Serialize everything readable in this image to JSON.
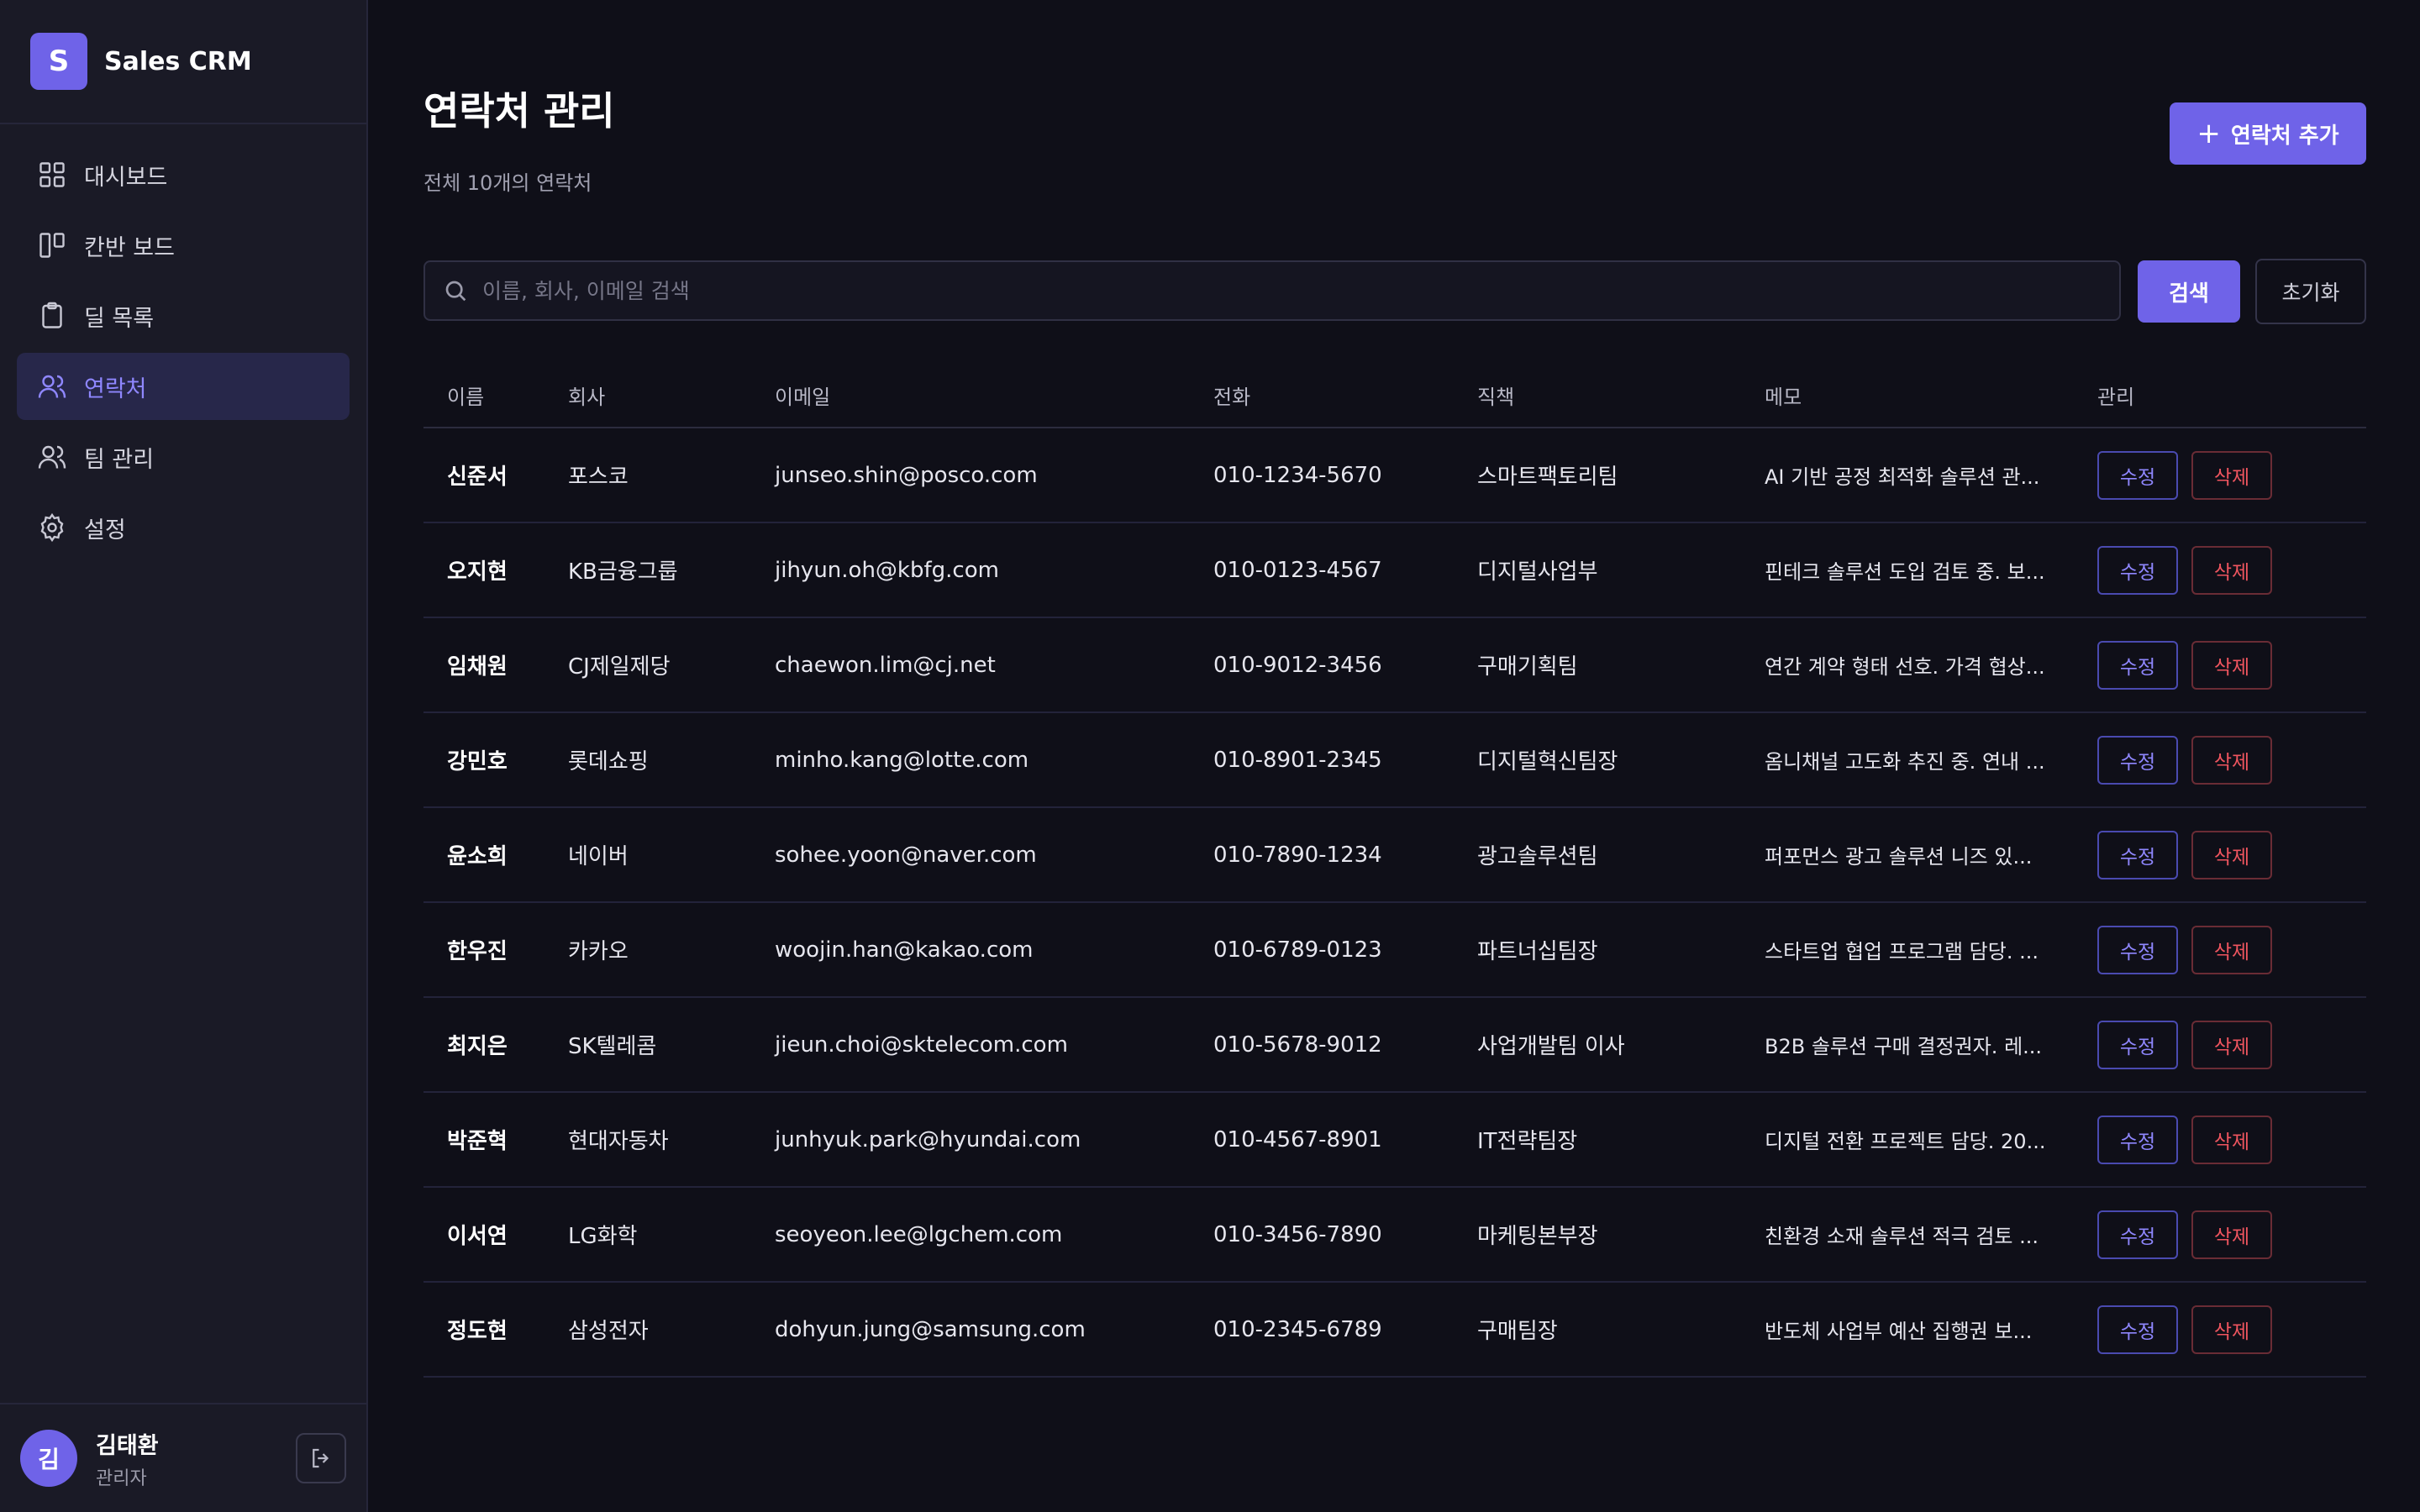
{
  "app": {
    "logo_letter": "S",
    "name": "Sales CRM"
  },
  "nav": [
    {
      "label": "대시보드",
      "icon": "dashboard-icon"
    },
    {
      "label": "칸반 보드",
      "icon": "kanban-icon"
    },
    {
      "label": "딜 목록",
      "icon": "clipboard-icon"
    },
    {
      "label": "연락처",
      "icon": "contacts-icon",
      "active": true
    },
    {
      "label": "팀 관리",
      "icon": "team-icon"
    },
    {
      "label": "설정",
      "icon": "gear-icon"
    }
  ],
  "user": {
    "avatar": "김",
    "name": "김태환",
    "role": "관리자"
  },
  "page": {
    "title": "연락처 관리",
    "subtitle": "전체 10개의 연락처",
    "add_label": "연락처 추가"
  },
  "search": {
    "placeholder": "이름, 회사, 이메일 검색",
    "value": "",
    "search_label": "검색",
    "reset_label": "초기화"
  },
  "table": {
    "headers": [
      "이름",
      "회사",
      "이메일",
      "전화",
      "직책",
      "메모",
      "관리"
    ],
    "edit_label": "수정",
    "delete_label": "삭제",
    "rows": [
      {
        "name": "신준서",
        "company": "포스코",
        "email": "junseo.shin@posco.com",
        "phone": "010-1234-5670",
        "title": "스마트팩토리팀",
        "memo": "AI 기반 공정 최적화 솔루션 관..."
      },
      {
        "name": "오지현",
        "company": "KB금융그룹",
        "email": "jihyun.oh@kbfg.com",
        "phone": "010-0123-4567",
        "title": "디지털사업부",
        "memo": "핀테크 솔루션 도입 검토 중. 보..."
      },
      {
        "name": "임채원",
        "company": "CJ제일제당",
        "email": "chaewon.lim@cj.net",
        "phone": "010-9012-3456",
        "title": "구매기획팀",
        "memo": "연간 계약 형태 선호. 가격 협상..."
      },
      {
        "name": "강민호",
        "company": "롯데쇼핑",
        "email": "minho.kang@lotte.com",
        "phone": "010-8901-2345",
        "title": "디지털혁신팀장",
        "memo": "옴니채널 고도화 추진 중. 연내 ..."
      },
      {
        "name": "윤소희",
        "company": "네이버",
        "email": "sohee.yoon@naver.com",
        "phone": "010-7890-1234",
        "title": "광고솔루션팀",
        "memo": "퍼포먼스 광고 솔루션 니즈 있..."
      },
      {
        "name": "한우진",
        "company": "카카오",
        "email": "woojin.han@kakao.com",
        "phone": "010-6789-0123",
        "title": "파트너십팀장",
        "memo": "스타트업 협업 프로그램 담당. ..."
      },
      {
        "name": "최지은",
        "company": "SK텔레콤",
        "email": "jieun.choi@sktelecom.com",
        "phone": "010-5678-9012",
        "title": "사업개발팀 이사",
        "memo": "B2B 솔루션 구매 결정권자. 레..."
      },
      {
        "name": "박준혁",
        "company": "현대자동차",
        "email": "junhyuk.park@hyundai.com",
        "phone": "010-4567-8901",
        "title": "IT전략팀장",
        "memo": "디지털 전환 프로젝트 담당. 20..."
      },
      {
        "name": "이서연",
        "company": "LG화학",
        "email": "seoyeon.lee@lgchem.com",
        "phone": "010-3456-7890",
        "title": "마케팅본부장",
        "memo": "친환경 소재 솔루션 적극 검토 ..."
      },
      {
        "name": "정도현",
        "company": "삼성전자",
        "email": "dohyun.jung@samsung.com",
        "phone": "010-2345-6789",
        "title": "구매팀장",
        "memo": "반도체 사업부 예산 집행권 보..."
      }
    ]
  },
  "colors": {
    "accent": "#6f63e8",
    "danger": "#f0555f",
    "background": "#0f0f18",
    "sidebar": "#1a1a26"
  }
}
